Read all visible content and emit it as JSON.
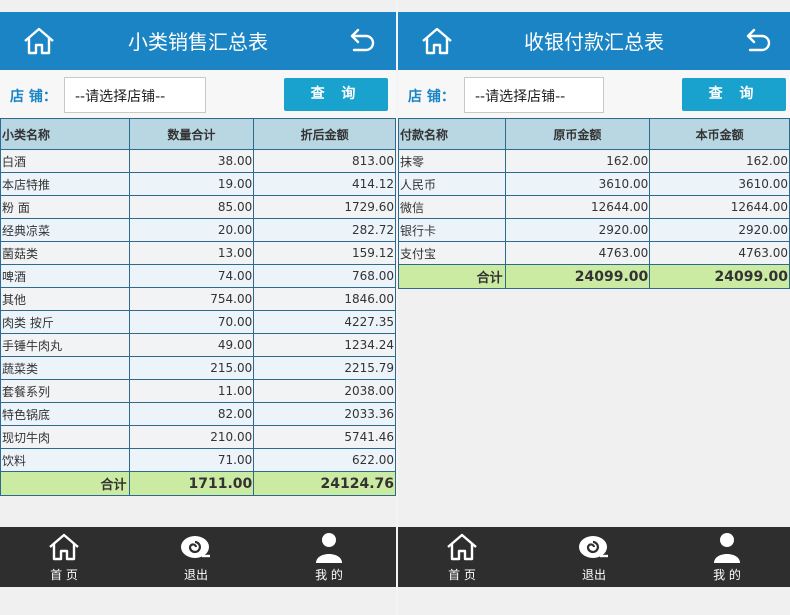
{
  "left": {
    "title": "小类销售汇总表",
    "store_label": "店 铺：",
    "store_placeholder": "--请选择店铺--",
    "query_button": "查 询",
    "columns": [
      "小类名称",
      "数量合计",
      "折后金额"
    ],
    "rows": [
      [
        "白酒",
        "38.00",
        "813.00"
      ],
      [
        "本店特推",
        "19.00",
        "414.12"
      ],
      [
        "粉 面",
        "85.00",
        "1729.60"
      ],
      [
        "经典凉菜",
        "20.00",
        "282.72"
      ],
      [
        "菌菇类",
        "13.00",
        "159.12"
      ],
      [
        "啤酒",
        "74.00",
        "768.00"
      ],
      [
        "其他",
        "754.00",
        "1846.00"
      ],
      [
        "肉类 按斤",
        "70.00",
        "4227.35"
      ],
      [
        "手锤牛肉丸",
        "49.00",
        "1234.24"
      ],
      [
        "蔬菜类",
        "215.00",
        "2215.79"
      ],
      [
        "套餐系列",
        "11.00",
        "2038.00"
      ],
      [
        "特色锅底",
        "82.00",
        "2033.36"
      ],
      [
        "现切牛肉",
        "210.00",
        "5741.46"
      ],
      [
        "饮料",
        "71.00",
        "622.00"
      ]
    ],
    "total": [
      "合计",
      "1711.00",
      "24124.76"
    ]
  },
  "right": {
    "title": "收银付款汇总表",
    "store_label": "店 铺：",
    "store_placeholder": "--请选择店铺--",
    "query_button": "查 询",
    "columns": [
      "付款名称",
      "原币金额",
      "本币金额"
    ],
    "rows": [
      [
        "抹零",
        "162.00",
        "162.00"
      ],
      [
        "人民币",
        "3610.00",
        "3610.00"
      ],
      [
        "微信",
        "12644.00",
        "12644.00"
      ],
      [
        "银行卡",
        "2920.00",
        "2920.00"
      ],
      [
        "支付宝",
        "4763.00",
        "4763.00"
      ]
    ],
    "total": [
      "合计",
      "24099.00",
      "24099.00"
    ]
  },
  "nav": {
    "home": "首 页",
    "logout": "退出",
    "mine": "我 的"
  },
  "icons": {
    "header_left": "home-icon",
    "header_right": "back-icon",
    "nav_home": "home-icon",
    "nav_logout": "snail-icon",
    "nav_mine": "user-icon"
  },
  "colors": {
    "header": "#1a84c5",
    "button": "#18a2cd",
    "table_header": "#b9d7e3",
    "total_row": "#cbeaa2",
    "footer": "#2e2e2e"
  }
}
